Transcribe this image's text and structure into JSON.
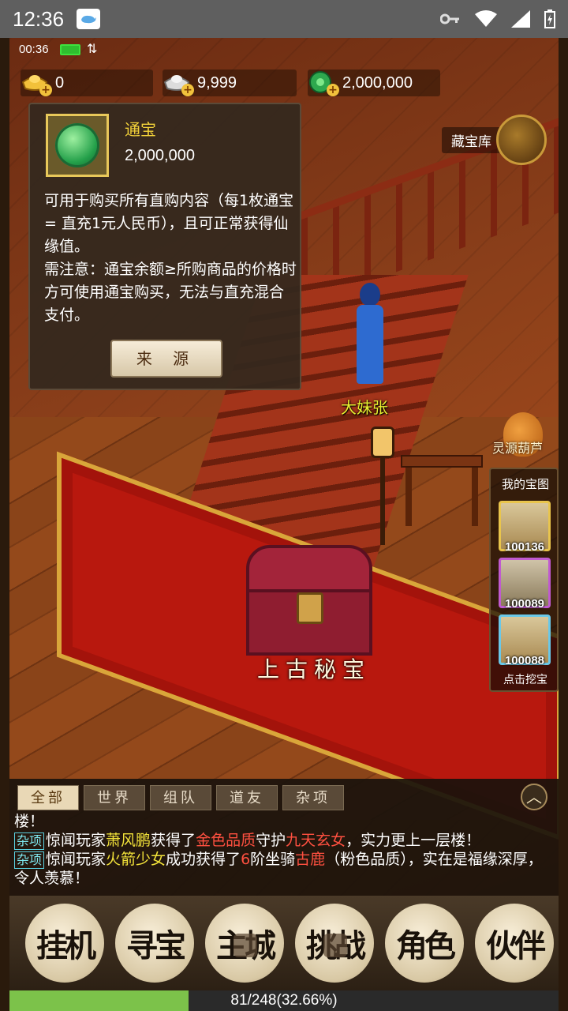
{
  "system": {
    "time": "12:36"
  },
  "game_status": {
    "time": "00:36"
  },
  "currencies": [
    {
      "icon": "gold-ingot-icon",
      "value": "0"
    },
    {
      "icon": "silver-ingot-icon",
      "value": "9,999"
    },
    {
      "icon": "jade-dragon-coin-icon",
      "value": "2,000,000"
    }
  ],
  "vault": {
    "label": "藏宝库"
  },
  "tooltip": {
    "name": "通宝",
    "amount": "2,000,000",
    "description_1": "可用于购买所有直购内容（每1枚通宝 = 直充1元人民币），且可正常获得仙缘值。",
    "description_2": "需注意：通宝余额≥所购商品的价格时方可使用通宝购买，无法与直充混合支付。",
    "source_button": "来 源"
  },
  "scene": {
    "npc_name": "大妹张",
    "chest_label": "上古秘宝",
    "gourd_label": "灵源葫芦"
  },
  "treasure_maps": {
    "title": "我的宝图",
    "items": [
      "100136",
      "100089",
      "100088"
    ],
    "dig_label": "点击挖宝"
  },
  "chat": {
    "tabs": [
      "全部",
      "世界",
      "组队",
      "道友",
      "杂项"
    ],
    "fragment": "楼！",
    "line1": {
      "tag": "杂项",
      "a": "惊闻玩家",
      "player": "萧风鹏",
      "b": "获得了",
      "quality": "金色品质",
      "c": "守护",
      "item": "九天玄女",
      "d": "，实力更上一层楼！"
    },
    "line2": {
      "tag": "杂项",
      "a": "惊闻玩家",
      "player": "火箭少女",
      "b": "成功获得了",
      "level": "6",
      "c": "阶坐骑",
      "item": "古鹿",
      "d": "（粉色品质），实在是福缘深厚，令人羡慕！"
    }
  },
  "bottom_nav": [
    {
      "label": "挂机",
      "locked": false
    },
    {
      "label": "寻宝",
      "locked": false
    },
    {
      "label": "主城",
      "locked": true
    },
    {
      "label": "挑战",
      "locked": true
    },
    {
      "label": "角色",
      "locked": false
    },
    {
      "label": "伙伴",
      "locked": false
    }
  ],
  "exp": {
    "text": "81/248(32.66%)",
    "fraction": 0.3266
  }
}
